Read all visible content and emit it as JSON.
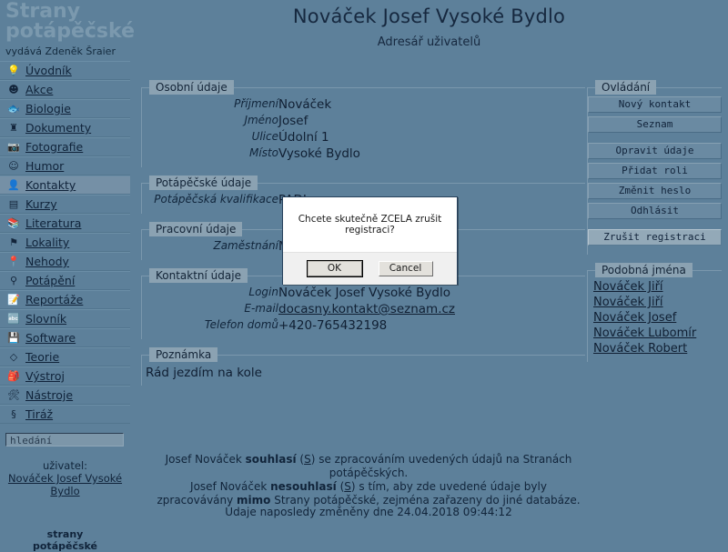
{
  "sidebar": {
    "brand_line1": "Strany",
    "brand_line2": "potápěčské",
    "publisher": "vydává Zdeněk Šraier",
    "items": [
      {
        "label": "Úvodník",
        "icon": "lightbulb-icon",
        "glyph": "💡"
      },
      {
        "label": "Akce",
        "icon": "face-icon",
        "glyph": "☻"
      },
      {
        "label": "Biologie",
        "icon": "fish-icon",
        "glyph": "🐟"
      },
      {
        "label": "Dokumenty",
        "icon": "stamp-icon",
        "glyph": "♜"
      },
      {
        "label": "Fotografie",
        "icon": "camera-icon",
        "glyph": "📷"
      },
      {
        "label": "Humor",
        "icon": "clown-icon",
        "glyph": "☺"
      },
      {
        "label": "Kontakty",
        "icon": "contacts-icon",
        "glyph": "👤"
      },
      {
        "label": "Kurzy",
        "icon": "certificate-icon",
        "glyph": "▤"
      },
      {
        "label": "Literatura",
        "icon": "books-icon",
        "glyph": "📚"
      },
      {
        "label": "Lokality",
        "icon": "diveflag-icon",
        "glyph": "⚑"
      },
      {
        "label": "Nehody",
        "icon": "pin-icon",
        "glyph": "📍"
      },
      {
        "label": "Potápění",
        "icon": "divermask-icon",
        "glyph": "⚲"
      },
      {
        "label": "Reportáže",
        "icon": "notepad-icon",
        "glyph": "📝"
      },
      {
        "label": "Slovník",
        "icon": "dictionary-icon",
        "glyph": "🔤"
      },
      {
        "label": "Software",
        "icon": "floppy-icon",
        "glyph": "💾"
      },
      {
        "label": "Teorie",
        "icon": "book-icon",
        "glyph": "◇"
      },
      {
        "label": "Výstroj",
        "icon": "gear-equipment-icon",
        "glyph": "🎒"
      },
      {
        "label": "Nástroje",
        "icon": "tools-icon",
        "glyph": "🛠"
      },
      {
        "label": "Tiráž",
        "icon": "paragraph-icon",
        "glyph": "§"
      }
    ],
    "active_item": "Kontakty",
    "search_placeholder": "hledání",
    "search_value": "",
    "user_label": "uživatel:",
    "user_name": "Nováček Josef Vysoké Bydlo",
    "footer_line1": "strany",
    "footer_line2": "potápěčské"
  },
  "header": {
    "title": "Nováček Josef Vysoké Bydlo",
    "subtitle": "Adresář uživatelů"
  },
  "sections": {
    "personal": {
      "legend": "Osobní údaje",
      "rows": [
        {
          "key": "Příjmení",
          "value": "Nováček"
        },
        {
          "key": "Jméno",
          "value": "Josef"
        },
        {
          "key": "Ulice",
          "value": "Údolní 1"
        },
        {
          "key": "Místo",
          "value": "Vysoké Bydlo"
        }
      ]
    },
    "diving": {
      "legend": "Potápěčské údaje",
      "rows": [
        {
          "key": "Potápěčská kvalifikace",
          "value": "PADI"
        }
      ]
    },
    "work": {
      "legend": "Pracovní údaje",
      "rows": [
        {
          "key": "Zaměstnání",
          "value": "Manipulátor"
        }
      ]
    },
    "contact": {
      "legend": "Kontaktní údaje",
      "rows": [
        {
          "key": "Login",
          "value": "Nováček Josef Vysoké Bydlo"
        },
        {
          "key": "E-mail",
          "value": "docasny.kontakt@seznam.cz"
        },
        {
          "key": "Telefon domů",
          "value": "+420-765432198"
        }
      ]
    },
    "note": {
      "legend": "Poznámka",
      "text": "Rád jezdím na kole"
    }
  },
  "consent": {
    "line1_a": "Josef Nováček ",
    "line1_b": "souhlasí",
    "line1_c": " (",
    "line1_s": "S",
    "line1_d": ") se zpracováním uvedených údajů na Stranách potápěčských.",
    "line2_a": "Josef Nováček ",
    "line2_b": "nesouhlasí",
    "line2_c": " (",
    "line2_s": "S",
    "line2_d": ") s tím, aby zde uvedené údaje byly",
    "line3_a": "zpracovávány ",
    "line3_b": "mimo",
    "line3_c": " Strany potápěčské, zejména zařazeny do jiné databáze.",
    "changed": "Údaje naposledy změněny dne 24.04.2018 09:44:12"
  },
  "controls": {
    "legend": "Ovládání",
    "buttons": [
      {
        "label": "Nový kontakt",
        "selected": false
      },
      {
        "label": "Seznam",
        "selected": false
      },
      {
        "label": "Opravit údaje",
        "selected": false
      },
      {
        "label": "Přidat roli",
        "selected": false
      },
      {
        "label": "Změnit heslo",
        "selected": false
      },
      {
        "label": "Odhlásit",
        "selected": false
      },
      {
        "label": "Zrušit registraci",
        "selected": true
      }
    ]
  },
  "similar": {
    "legend": "Podobná jména",
    "names": [
      "Nováček Jiří",
      "Nováček Jiří",
      "Nováček Josef",
      "Nováček Lubomír",
      "Nováček Robert"
    ]
  },
  "dialog": {
    "message": "Chcete skutečně ZCELA zrušit registraci?",
    "ok_label": "OK",
    "cancel_label": "Cancel"
  }
}
